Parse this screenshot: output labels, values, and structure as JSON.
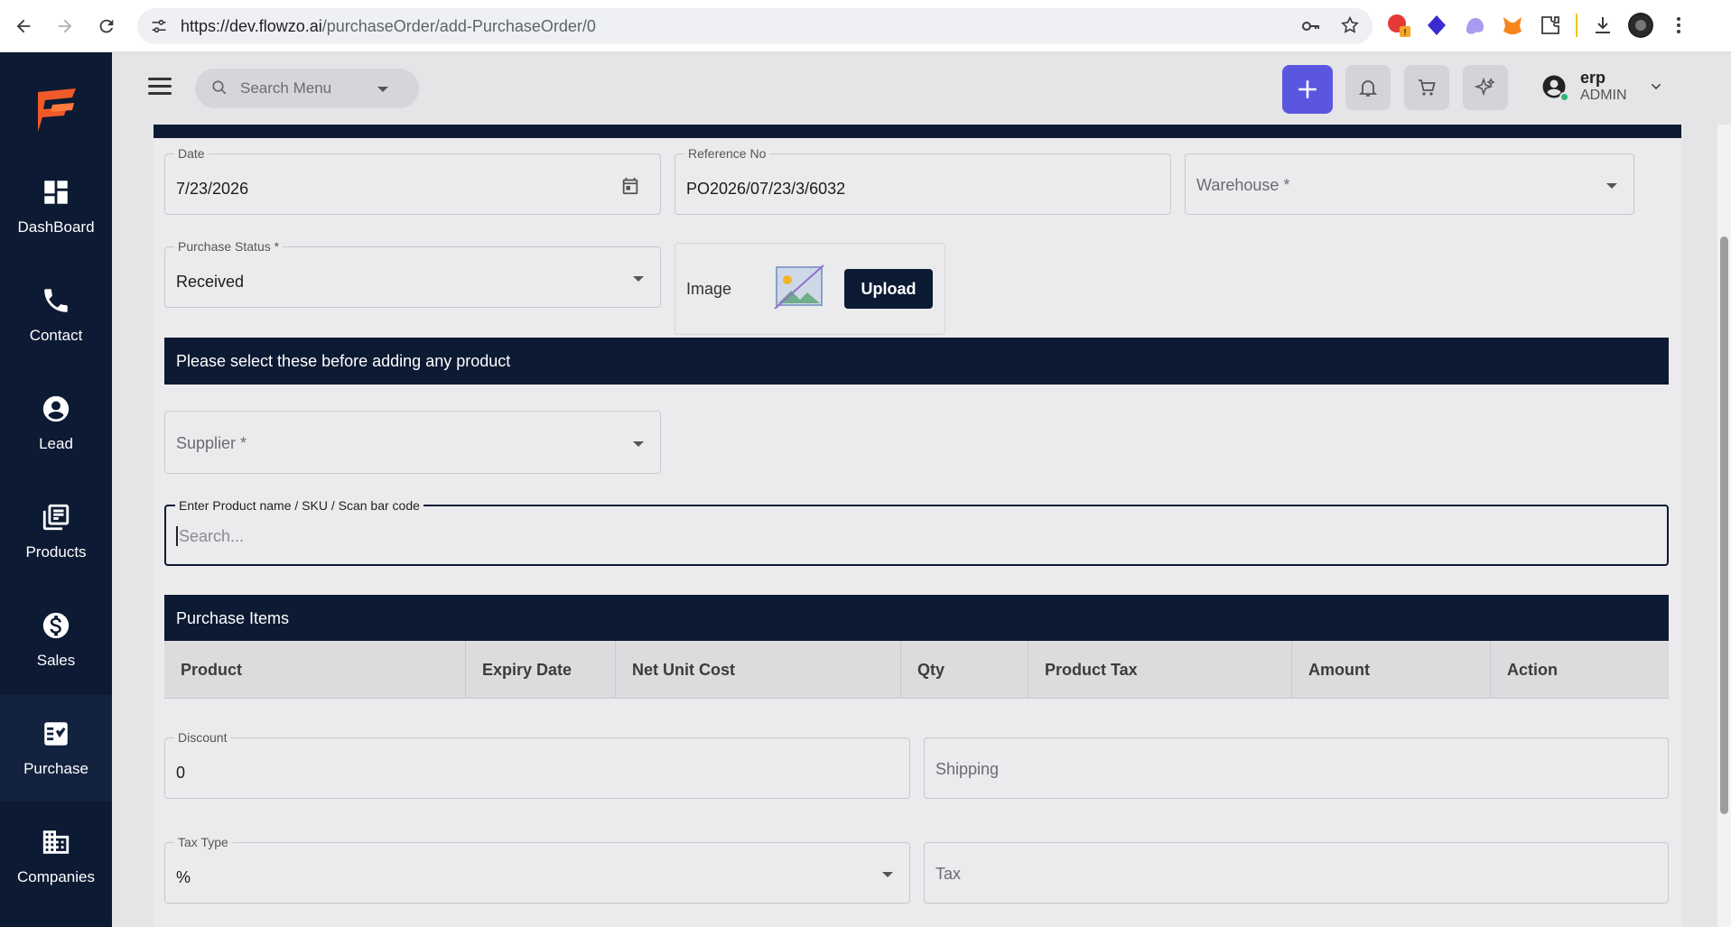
{
  "browser": {
    "url_host": "https://dev.flowzo.ai",
    "url_path": "/purchaseOrder/add-PurchaseOrder/0"
  },
  "sidebar": {
    "items": [
      {
        "label": "DashBoard",
        "icon": "dashboard-icon"
      },
      {
        "label": "Contact",
        "icon": "phone-icon"
      },
      {
        "label": "Lead",
        "icon": "account-circle-icon"
      },
      {
        "label": "Products",
        "icon": "products-icon"
      },
      {
        "label": "Sales",
        "icon": "dollar-icon"
      },
      {
        "label": "Purchase",
        "icon": "purchase-icon"
      },
      {
        "label": "Companies",
        "icon": "companies-icon"
      }
    ],
    "active": "Purchase"
  },
  "header": {
    "search_placeholder": "Search Menu",
    "user_name": "erp",
    "user_role": "ADMIN",
    "accent": "#5b56e0"
  },
  "form": {
    "date": {
      "label": "Date",
      "value": "7/23/2026"
    },
    "reference": {
      "label": "Reference No",
      "value": "PO2026/07/23/3/6032"
    },
    "warehouse": {
      "placeholder": "Warehouse *"
    },
    "purchase_status": {
      "label": "Purchase Status *",
      "value": "Received"
    },
    "image": {
      "label": "Image",
      "upload_label": "Upload"
    },
    "notice": "Please select these before adding any product",
    "supplier": {
      "placeholder": "Supplier *"
    },
    "product_search": {
      "label": "Enter Product name / SKU / Scan bar code",
      "placeholder": "Search..."
    },
    "items_title": "Purchase Items",
    "columns": [
      "Product",
      "Expiry Date",
      "Net Unit Cost",
      "Qty",
      "Product Tax",
      "Amount",
      "Action"
    ],
    "discount": {
      "label": "Discount",
      "value": "0"
    },
    "shipping": {
      "placeholder": "Shipping"
    },
    "tax_type": {
      "label": "Tax Type",
      "value": "%"
    },
    "tax": {
      "placeholder": "Tax"
    }
  },
  "colors": {
    "navy": "#0c1a33",
    "background": "#e5e5e8"
  }
}
